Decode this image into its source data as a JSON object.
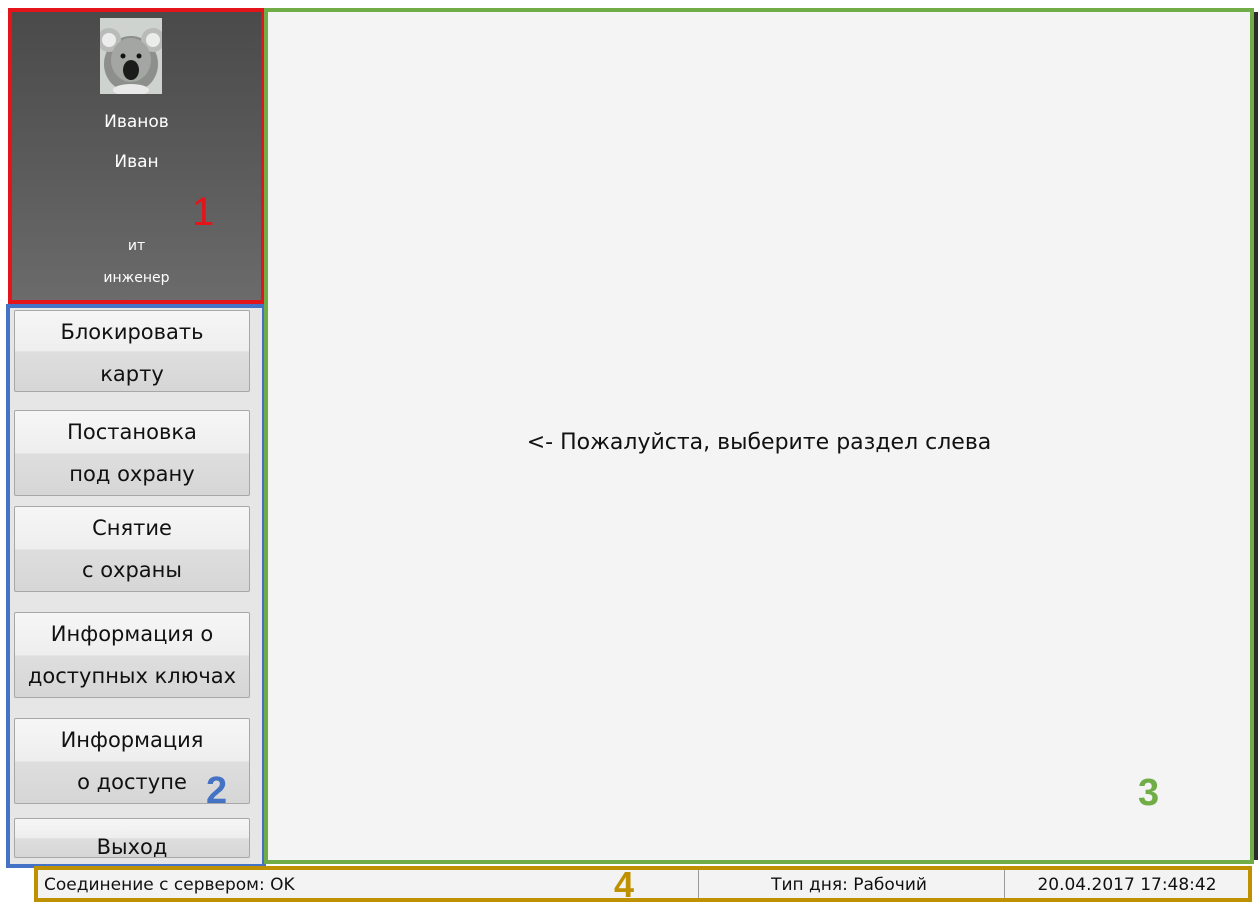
{
  "profile": {
    "avatar_icon": "koala-avatar-icon",
    "last_name": "Иванов",
    "first_name": "Иван",
    "department": "ит",
    "position": "инженер"
  },
  "menu": {
    "buttons": [
      {
        "line1": "Блокировать",
        "line2": "карту"
      },
      {
        "line1": "Постановка",
        "line2": "под охрану"
      },
      {
        "line1": "Снятие",
        "line2": "с охраны"
      },
      {
        "line1": "Информация о",
        "line2": "доступных ключах"
      },
      {
        "line1": "Информация",
        "line2": "о доступе"
      },
      {
        "line1": "Выход",
        "line2": ""
      }
    ]
  },
  "main": {
    "hint": "<- Пожалуйста, выберите раздел слева"
  },
  "status": {
    "connection": "Соединение с сервером: OK",
    "day_type": "Тип дня: Рабочий",
    "datetime": "20.04.2017 17:48:42"
  },
  "region_labels": [
    "1",
    "2",
    "3",
    "4"
  ],
  "colors": {
    "region1": "#e4141b",
    "region2": "#4472c4",
    "region3": "#70ad47",
    "region4": "#bf9000"
  }
}
